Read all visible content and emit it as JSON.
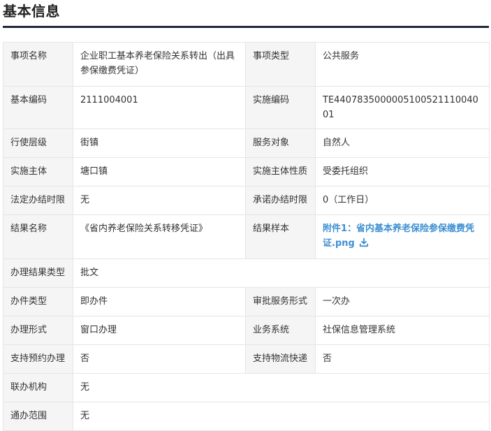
{
  "section": {
    "title": "基本信息"
  },
  "rows": {
    "item_name": {
      "label": "事项名称",
      "value": "企业职工基本养老保险关系转出（出具参保缴费凭证）"
    },
    "item_type": {
      "label": "事项类型",
      "value": "公共服务"
    },
    "basic_code": {
      "label": "基本编码",
      "value": "2111004001"
    },
    "impl_code": {
      "label": "实施编码",
      "value": "TE440783500000510052111004001"
    },
    "exercise_level": {
      "label": "行使层级",
      "value": "街镇"
    },
    "service_target": {
      "label": "服务对象",
      "value": "自然人"
    },
    "impl_subject": {
      "label": "实施主体",
      "value": "塘口镇"
    },
    "impl_subject_nature": {
      "label": "实施主体性质",
      "value": "受委托组织"
    },
    "legal_time_limit": {
      "label": "法定办结时限",
      "value": "无"
    },
    "promised_time_limit": {
      "label": "承诺办结时限",
      "value": "0（工作日）"
    },
    "result_name": {
      "label": "结果名称",
      "value": "《省内养老保险关系转移凭证》"
    },
    "result_sample": {
      "label": "结果样本",
      "link_text": "附件1：省内基本养老保险参保缴费凭证.png"
    },
    "result_type": {
      "label": "办理结果类型",
      "value": "批文"
    },
    "case_type": {
      "label": "办件类型",
      "value": "即办件"
    },
    "approval_form": {
      "label": "审批服务形式",
      "value": "一次办"
    },
    "handling_form": {
      "label": "办理形式",
      "value": "窗口办理"
    },
    "business_system": {
      "label": "业务系统",
      "value": "社保信息管理系统"
    },
    "reservation": {
      "label": "支持预约办理",
      "value": "否"
    },
    "logistics": {
      "label": "支持物流快递",
      "value": "否"
    },
    "joint_agency": {
      "label": "联办机构",
      "value": "无"
    },
    "general_scope": {
      "label": "通办范围",
      "value": "无"
    }
  },
  "icons": {
    "download": "download-icon"
  },
  "colors": {
    "link": "#3d8fd1",
    "label_bg": "#f5f5f5",
    "border": "#e5e5e5",
    "rule": "#1f2937"
  }
}
